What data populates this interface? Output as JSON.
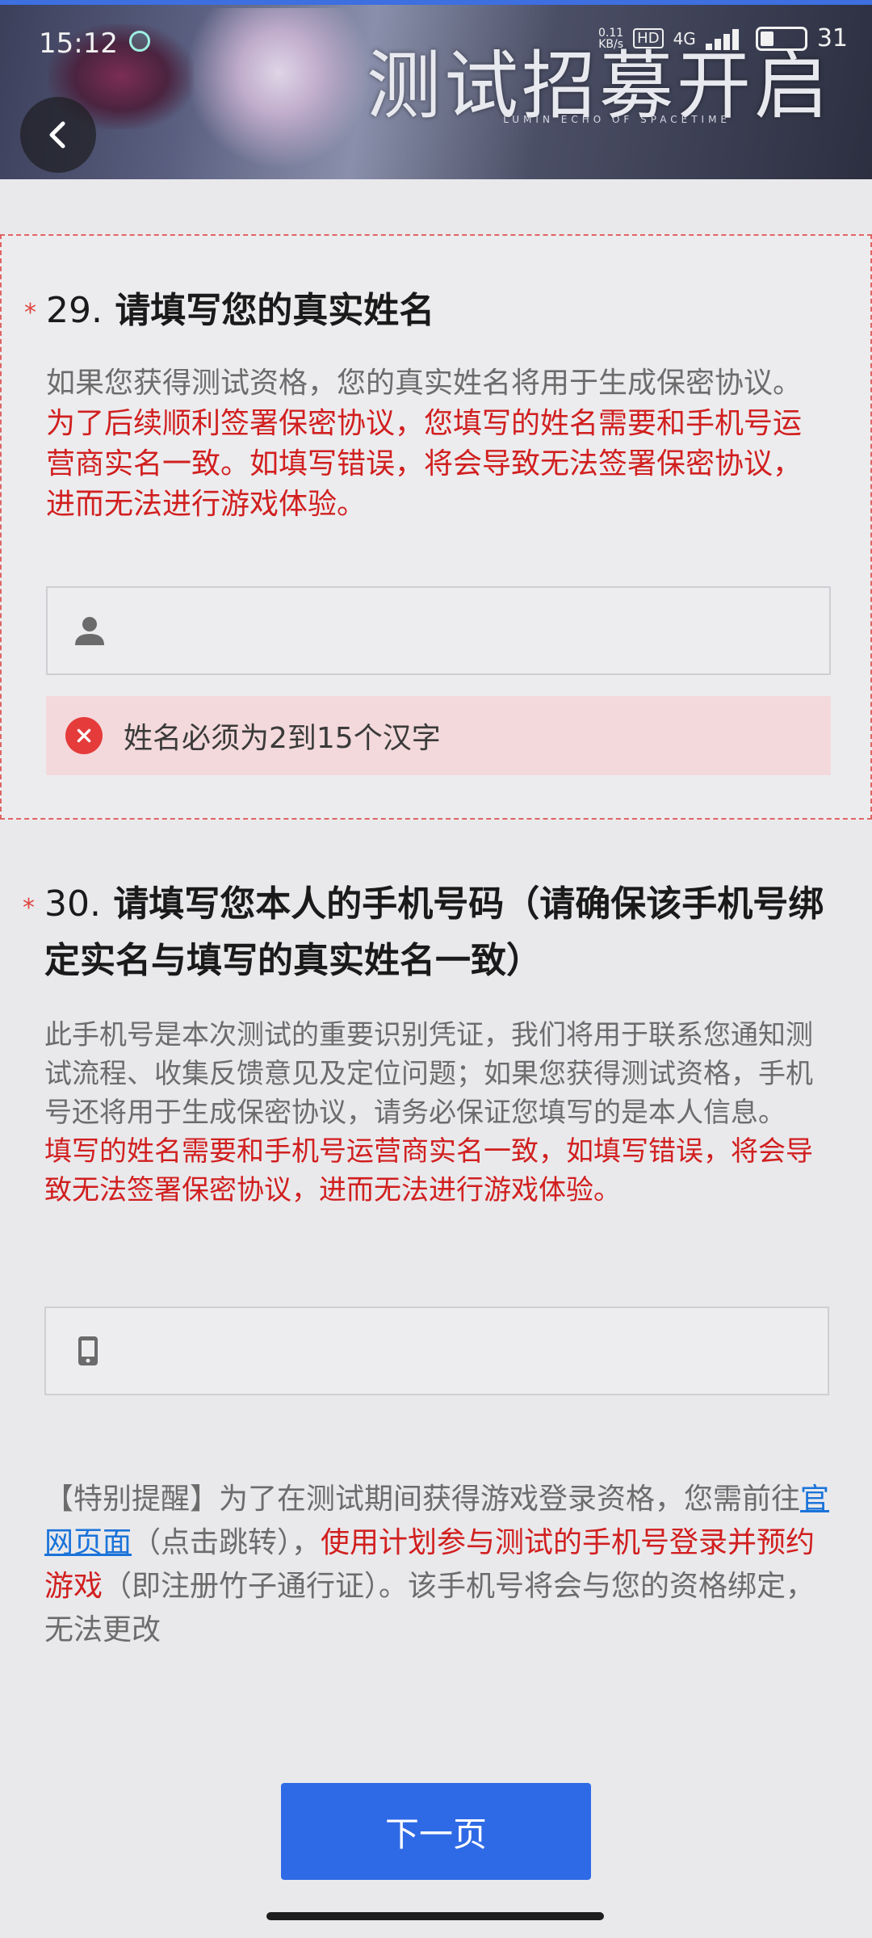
{
  "status_bar": {
    "time": "15:12",
    "net_speed": "0.11",
    "net_unit": "KB/s",
    "hd": "HD",
    "network": "4G",
    "battery": "31"
  },
  "banner": {
    "title": "测试招募开启",
    "subtitle": "LUMIN ECHO OF SPACETIME"
  },
  "questions": {
    "q29": {
      "required_mark": "*",
      "number": "29.",
      "title": "请填写您的真实姓名",
      "desc": "如果您获得测试资格，您的真实姓名将用于生成保密协议。",
      "warning": "为了后续顺利签署保密协议，您填写的姓名需要和手机号运营商实名一致。如填写错误，将会导致无法签署保密协议，进而无法进行游戏体验。",
      "input_value": "",
      "error": "姓名必须为2到15个汉字"
    },
    "q30": {
      "required_mark": "*",
      "number": "30.",
      "title": "请填写您本人的手机号码（请确保该手机号绑定实名与填写的真实姓名一致）",
      "desc": "此手机号是本次测试的重要识别凭证，我们将用于联系您通知测试流程、收集反馈意见及定位问题；如果您获得测试资格，手机号还将用于生成保密协议，请务必保证您填写的是本人信息。",
      "warning": "填写的姓名需要和手机号运营商实名一致，如填写错误，将会导致无法签署保密协议，进而无法进行游戏体验。",
      "input_value": ""
    }
  },
  "reminder": {
    "prefix": "【特别提醒】为了在测试期间获得游戏登录资格，您需前往",
    "link": "官网页面",
    "jump": "（点击跳转），",
    "emphasis": "使用计划参与测试的手机号登录并预约游戏",
    "suffix": "（即注册竹子通行证）。该手机号将会与您的资格绑定，无法更改"
  },
  "next_button": "下一页",
  "colors": {
    "accent": "#2f6ae6",
    "warning": "#d11f1f",
    "error_bg": "#f3d9dc",
    "link": "#1a73d9"
  }
}
